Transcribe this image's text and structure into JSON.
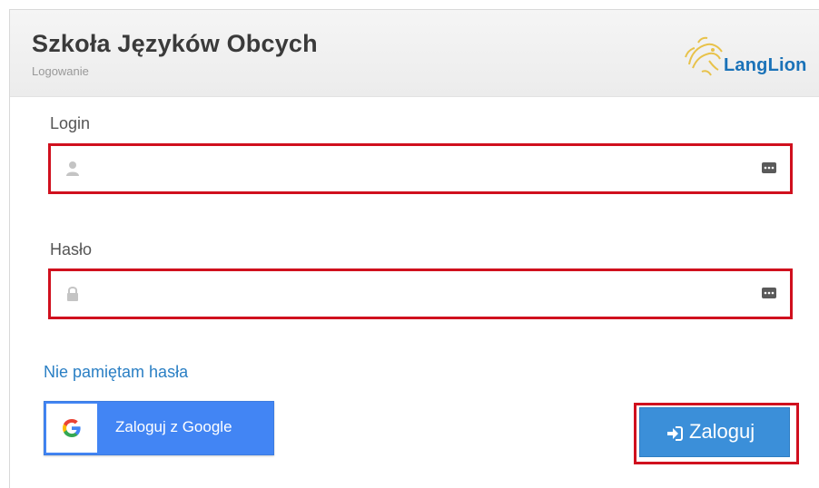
{
  "header": {
    "title": "Szkoła Języków Obcych",
    "subtitle": "Logowanie",
    "logo_text": "LangLion"
  },
  "form": {
    "login_label": "Login",
    "login_value": "",
    "login_lead_icon": "user-icon",
    "login_trail_icon": "password-manager-icon",
    "password_label": "Hasło",
    "password_value": "",
    "password_lead_icon": "lock-icon",
    "password_trail_icon": "password-manager-icon",
    "forgot_link": "Nie pamiętam hasła",
    "google_button": "Zaloguj z Google",
    "login_button": "Zaloguj",
    "login_button_icon": "sign-in-icon"
  },
  "colors": {
    "highlight_border": "#d0101e",
    "link": "#2a7fc4",
    "google_blue": "#4285f4",
    "primary_button": "#3b8fd9",
    "logo_text": "#1a72b8"
  }
}
